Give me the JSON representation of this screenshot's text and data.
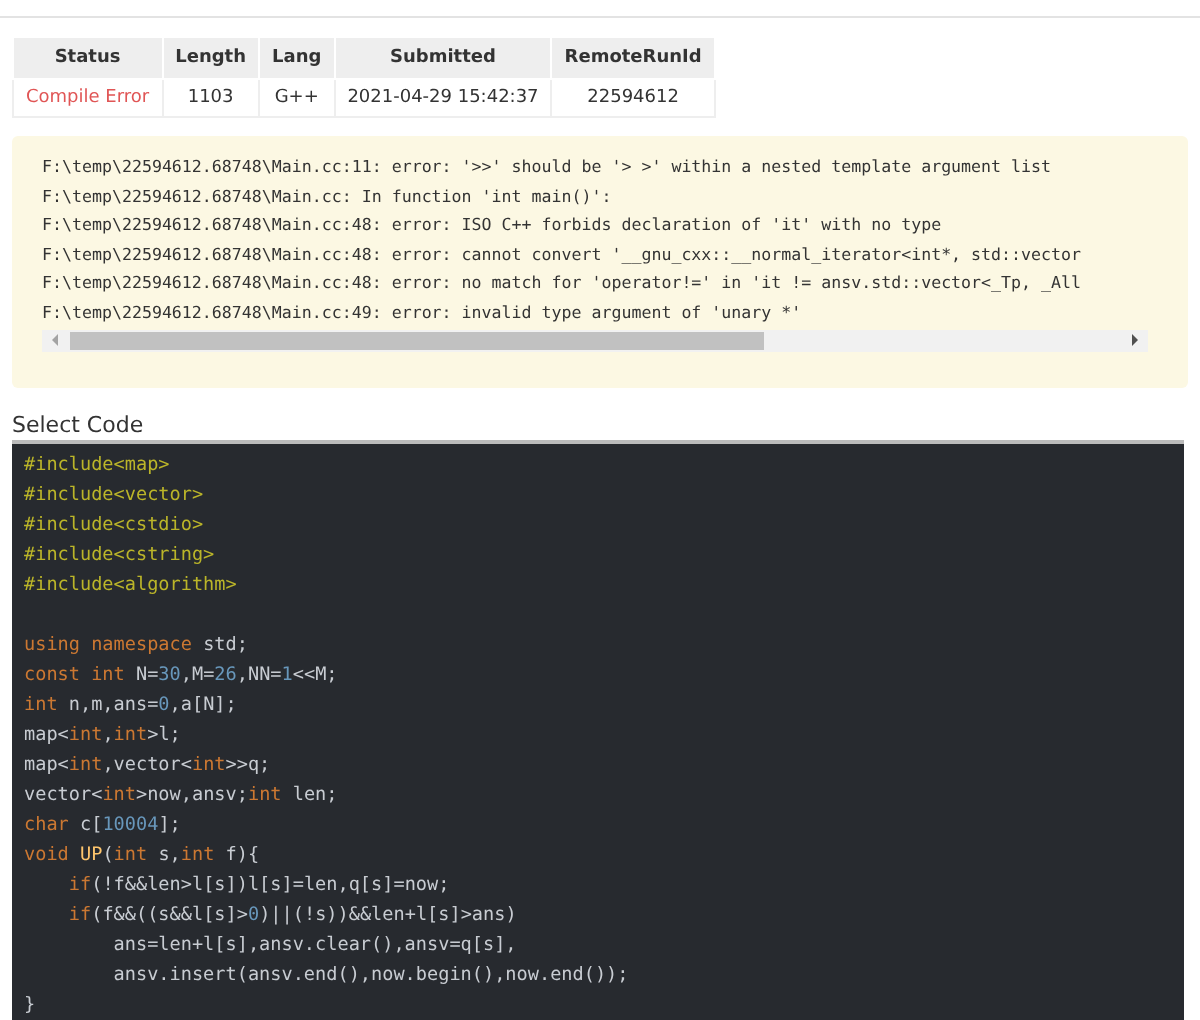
{
  "submission_table": {
    "columns": [
      "Status",
      "Length",
      "Lang",
      "Submitted",
      "RemoteRunId"
    ],
    "rows": [
      {
        "status": "Compile Error",
        "length": "1103",
        "lang": "G++",
        "submitted": "2021-04-29 15:42:37",
        "remote_run_id": "22594612"
      }
    ]
  },
  "compile_log": {
    "lines": [
      "F:\\temp\\22594612.68748\\Main.cc:11: error: '>>' should be '> >' within a nested template argument list",
      "F:\\temp\\22594612.68748\\Main.cc: In function 'int main()':",
      "F:\\temp\\22594612.68748\\Main.cc:48: error: ISO C++ forbids declaration of 'it' with no type",
      "F:\\temp\\22594612.68748\\Main.cc:48: error: cannot convert '__gnu_cxx::__normal_iterator<int*, std::vector",
      "F:\\temp\\22594612.68748\\Main.cc:48: error: no match for 'operator!=' in 'it != ansv.std::vector<_Tp, _All",
      "F:\\temp\\22594612.68748\\Main.cc:49: error: invalid type argument of 'unary *'"
    ]
  },
  "code_section": {
    "label": "Select Code",
    "lines": [
      {
        "tokens": [
          {
            "kind": "pre",
            "text": "#include<map>"
          }
        ]
      },
      {
        "tokens": [
          {
            "kind": "pre",
            "text": "#include<vector>"
          }
        ]
      },
      {
        "tokens": [
          {
            "kind": "pre",
            "text": "#include<cstdio>"
          }
        ]
      },
      {
        "tokens": [
          {
            "kind": "pre",
            "text": "#include<cstring>"
          }
        ]
      },
      {
        "tokens": [
          {
            "kind": "pre",
            "text": "#include<algorithm>"
          }
        ]
      },
      {
        "gap_above": true,
        "tokens": [
          {
            "kind": "kw",
            "text": "using namespace"
          },
          {
            "kind": "plain",
            "text": " std;"
          }
        ]
      },
      {
        "tokens": [
          {
            "kind": "kw",
            "text": "const int"
          },
          {
            "kind": "plain",
            "text": " N="
          },
          {
            "kind": "num",
            "text": "30"
          },
          {
            "kind": "plain",
            "text": ",M="
          },
          {
            "kind": "num",
            "text": "26"
          },
          {
            "kind": "plain",
            "text": ",NN="
          },
          {
            "kind": "num",
            "text": "1"
          },
          {
            "kind": "plain",
            "text": "<<M;"
          }
        ]
      },
      {
        "tokens": [
          {
            "kind": "kw",
            "text": "int"
          },
          {
            "kind": "plain",
            "text": " n,m,ans="
          },
          {
            "kind": "num",
            "text": "0"
          },
          {
            "kind": "plain",
            "text": ",a[N];"
          }
        ]
      },
      {
        "tokens": [
          {
            "kind": "plain",
            "text": "map<"
          },
          {
            "kind": "kw",
            "text": "int"
          },
          {
            "kind": "plain",
            "text": ","
          },
          {
            "kind": "kw",
            "text": "int"
          },
          {
            "kind": "plain",
            "text": ">l;"
          }
        ]
      },
      {
        "tokens": [
          {
            "kind": "plain",
            "text": "map<"
          },
          {
            "kind": "kw",
            "text": "int"
          },
          {
            "kind": "plain",
            "text": ",vector<"
          },
          {
            "kind": "kw",
            "text": "int"
          },
          {
            "kind": "plain",
            "text": ">>q;"
          }
        ]
      },
      {
        "tokens": [
          {
            "kind": "plain",
            "text": "vector<"
          },
          {
            "kind": "kw",
            "text": "int"
          },
          {
            "kind": "plain",
            "text": ">now,ansv;"
          },
          {
            "kind": "kw",
            "text": "int"
          },
          {
            "kind": "plain",
            "text": " len;"
          }
        ]
      },
      {
        "tokens": [
          {
            "kind": "kw",
            "text": "char"
          },
          {
            "kind": "plain",
            "text": " c["
          },
          {
            "kind": "num",
            "text": "10004"
          },
          {
            "kind": "plain",
            "text": "];"
          }
        ]
      },
      {
        "tokens": [
          {
            "kind": "kw",
            "text": "void"
          },
          {
            "kind": "fn",
            "text": " UP"
          },
          {
            "kind": "plain",
            "text": "("
          },
          {
            "kind": "kw",
            "text": "int"
          },
          {
            "kind": "plain",
            "text": " s,"
          },
          {
            "kind": "kw",
            "text": "int"
          },
          {
            "kind": "plain",
            "text": " f){"
          }
        ]
      },
      {
        "tokens": [
          {
            "kind": "kw",
            "text": "    if"
          },
          {
            "kind": "plain",
            "text": "(!f&&len>l[s])l[s]=len,q[s]=now;"
          }
        ]
      },
      {
        "tokens": [
          {
            "kind": "kw",
            "text": "    if"
          },
          {
            "kind": "plain",
            "text": "(f&&((s&&l[s]>"
          },
          {
            "kind": "num",
            "text": "0"
          },
          {
            "kind": "plain",
            "text": ")||(!s))&&len+l[s]>ans)"
          }
        ]
      },
      {
        "tokens": [
          {
            "kind": "plain",
            "text": "        ans=len+l[s],ansv.clear(),ansv=q[s],"
          }
        ]
      },
      {
        "tokens": [
          {
            "kind": "plain",
            "text": "        ansv.insert(ansv.end(),now.begin(),now.end());"
          }
        ]
      },
      {
        "tokens": [
          {
            "kind": "plain",
            "text": "}"
          }
        ]
      }
    ]
  }
}
